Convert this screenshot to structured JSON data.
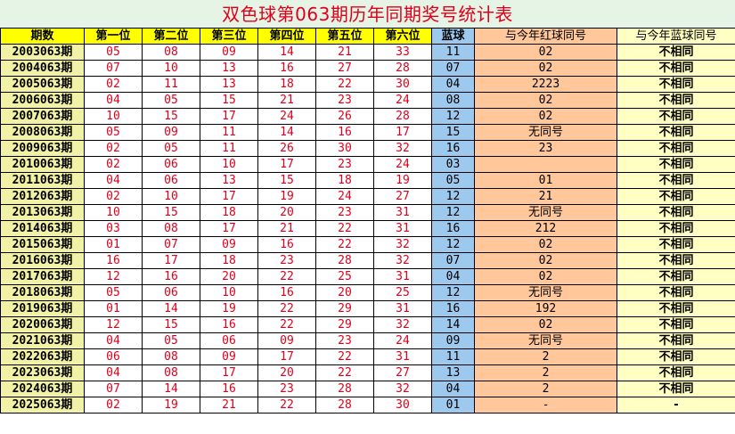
{
  "title": "双色球第063期历年同期奖号统计表",
  "headers": [
    "期数",
    "第一位",
    "第二位",
    "第三位",
    "第四位",
    "第五位",
    "第六位",
    "蓝球",
    "与今年红球同号",
    "与今年蓝球同号"
  ],
  "rows": [
    {
      "period": "2003063期",
      "reds": [
        "05",
        "08",
        "09",
        "14",
        "21",
        "33"
      ],
      "blue": "11",
      "red_match": "02",
      "blue_match": "不相同"
    },
    {
      "period": "2004063期",
      "reds": [
        "07",
        "10",
        "13",
        "16",
        "27",
        "28"
      ],
      "blue": "07",
      "red_match": "02",
      "blue_match": "不相同"
    },
    {
      "period": "2005063期",
      "reds": [
        "02",
        "11",
        "13",
        "18",
        "22",
        "30"
      ],
      "blue": "04",
      "red_match": "2223",
      "blue_match": "不相同"
    },
    {
      "period": "2006063期",
      "reds": [
        "04",
        "05",
        "15",
        "21",
        "23",
        "24"
      ],
      "blue": "08",
      "red_match": "02",
      "blue_match": "不相同"
    },
    {
      "period": "2007063期",
      "reds": [
        "10",
        "15",
        "17",
        "24",
        "26",
        "28"
      ],
      "blue": "12",
      "red_match": "02",
      "blue_match": "不相同"
    },
    {
      "period": "2008063期",
      "reds": [
        "05",
        "09",
        "11",
        "14",
        "16",
        "17"
      ],
      "blue": "15",
      "red_match": "无同号",
      "blue_match": "不相同"
    },
    {
      "period": "2009063期",
      "reds": [
        "02",
        "05",
        "11",
        "26",
        "30",
        "32"
      ],
      "blue": "16",
      "red_match": "23",
      "blue_match": "不相同"
    },
    {
      "period": "2010063期",
      "reds": [
        "02",
        "06",
        "10",
        "17",
        "23",
        "24"
      ],
      "blue": "03",
      "red_match": "",
      "blue_match": "不相同"
    },
    {
      "period": "2011063期",
      "reds": [
        "04",
        "06",
        "13",
        "15",
        "18",
        "19"
      ],
      "blue": "05",
      "red_match": "01",
      "blue_match": "不相同"
    },
    {
      "period": "2012063期",
      "reds": [
        "02",
        "10",
        "17",
        "19",
        "24",
        "27"
      ],
      "blue": "12",
      "red_match": "21",
      "blue_match": "不相同"
    },
    {
      "period": "2013063期",
      "reds": [
        "10",
        "15",
        "18",
        "20",
        "23",
        "31"
      ],
      "blue": "12",
      "red_match": "无同号",
      "blue_match": "不相同"
    },
    {
      "period": "2014063期",
      "reds": [
        "03",
        "08",
        "17",
        "21",
        "22",
        "31"
      ],
      "blue": "16",
      "red_match": "212",
      "blue_match": "不相同"
    },
    {
      "period": "2015063期",
      "reds": [
        "01",
        "07",
        "09",
        "16",
        "22",
        "32"
      ],
      "blue": "12",
      "red_match": "02",
      "blue_match": "不相同"
    },
    {
      "period": "2016063期",
      "reds": [
        "16",
        "17",
        "18",
        "23",
        "28",
        "32"
      ],
      "blue": "07",
      "red_match": "02",
      "blue_match": "不相同"
    },
    {
      "period": "2017063期",
      "reds": [
        "12",
        "16",
        "20",
        "22",
        "25",
        "31"
      ],
      "blue": "04",
      "red_match": "02",
      "blue_match": "不相同"
    },
    {
      "period": "2018063期",
      "reds": [
        "05",
        "06",
        "10",
        "16",
        "20",
        "25"
      ],
      "blue": "12",
      "red_match": "无同号",
      "blue_match": "不相同"
    },
    {
      "period": "2019063期",
      "reds": [
        "01",
        "14",
        "19",
        "22",
        "29",
        "31"
      ],
      "blue": "16",
      "red_match": "192",
      "blue_match": "不相同"
    },
    {
      "period": "2020063期",
      "reds": [
        "12",
        "15",
        "16",
        "22",
        "29",
        "32"
      ],
      "blue": "14",
      "red_match": "02",
      "blue_match": "不相同"
    },
    {
      "period": "2021063期",
      "reds": [
        "04",
        "05",
        "06",
        "09",
        "23",
        "24"
      ],
      "blue": "09",
      "red_match": "无同号",
      "blue_match": "不相同"
    },
    {
      "period": "2022063期",
      "reds": [
        "06",
        "08",
        "09",
        "17",
        "22",
        "31"
      ],
      "blue": "11",
      "red_match": "2",
      "blue_match": "不相同"
    },
    {
      "period": "2023063期",
      "reds": [
        "04",
        "08",
        "17",
        "20",
        "22",
        "27"
      ],
      "blue": "13",
      "red_match": "2",
      "blue_match": "不相同"
    },
    {
      "period": "2024063期",
      "reds": [
        "07",
        "14",
        "16",
        "23",
        "28",
        "32"
      ],
      "blue": "04",
      "red_match": "2",
      "blue_match": "不相同"
    },
    {
      "period": "2025063期",
      "reds": [
        "02",
        "19",
        "21",
        "22",
        "28",
        "30"
      ],
      "blue": "01",
      "red_match": "-",
      "blue_match": "-"
    }
  ],
  "colors": {
    "title_text": "#e0001b",
    "title_bg": "#e5f4e5",
    "header_bg": "#ffff00",
    "period_bg": "#f2f2a6",
    "red_number": "#e0001b",
    "blue_bg": "#9ec9ef",
    "red_match_bg": "#ffc79a",
    "blue_match_bg": "#ffffc4"
  }
}
